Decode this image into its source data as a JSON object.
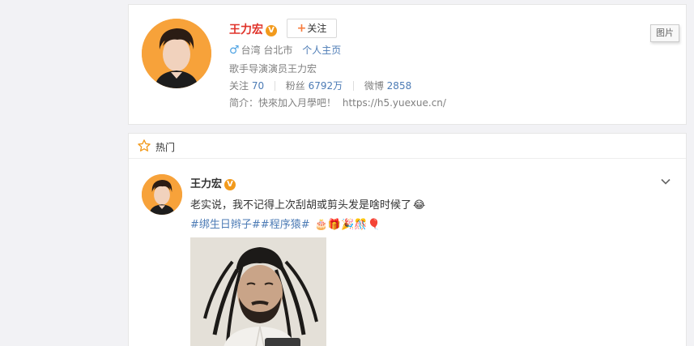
{
  "profile": {
    "name": "王力宏",
    "verified_badge": "V",
    "follow_label": "关注",
    "photo_label": "图片",
    "location": "台湾 台北市",
    "homepage_label": "个人主页",
    "bio": "歌手导演演员王力宏",
    "stats": {
      "following_label": "关注",
      "following_value": "70",
      "followers_label": "粉丝",
      "followers_value": "6792万",
      "weibo_label": "微博",
      "weibo_value": "2858"
    },
    "intro_label": "简介：",
    "intro_text": "快來加入月學吧！",
    "intro_link": "https://h5.yuexue.cn/"
  },
  "feed": {
    "section_label": "热门",
    "post": {
      "author": "王力宏",
      "verified_badge": "V",
      "text": "老实说，我不记得上次刮胡或剪头发是啥时候了",
      "text_emoji": "😂",
      "tag1": "#绑生日辫子#",
      "tag2": "#程序猿#",
      "tag_emojis": "🎂🎁🎉🎊🎈"
    }
  },
  "colors": {
    "accent_orange": "#f77c3d",
    "link_blue": "#4c7bb5",
    "name_red": "#e0332a",
    "badge_orange": "#f29a1c"
  },
  "icons": [
    "male-icon",
    "star-icon",
    "chevron-down-icon",
    "verified-icon",
    "plus-icon"
  ]
}
